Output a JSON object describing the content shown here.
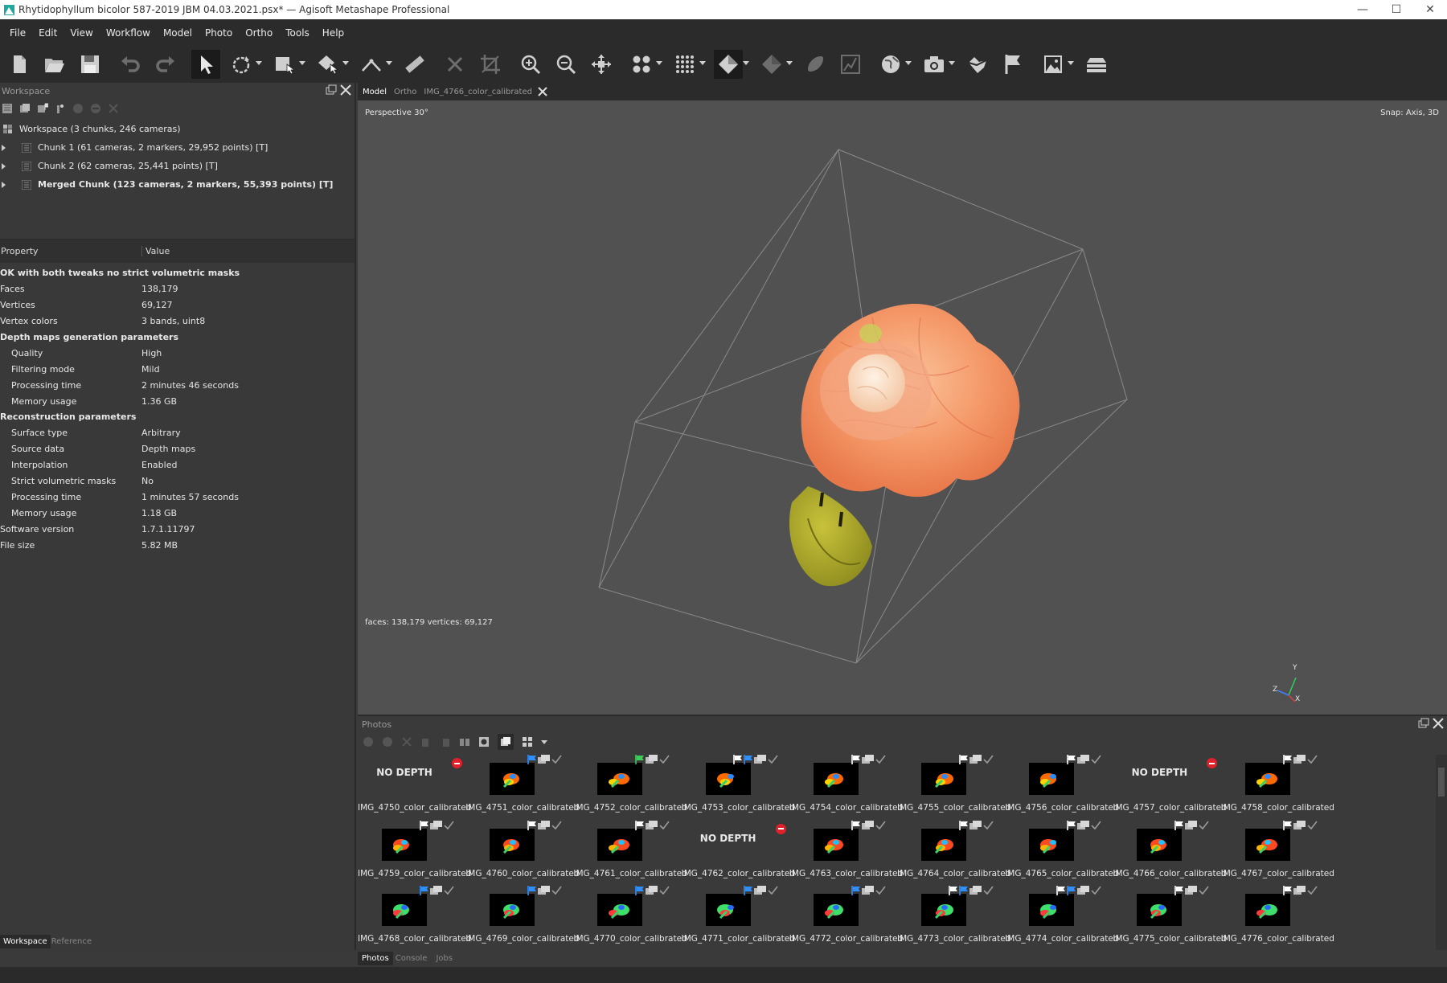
{
  "window": {
    "title": "Rhytidophyllum bicolor 587-2019 JBM 04.03.2021.psx* — Agisoft Metashape Professional",
    "minimize": "—",
    "maximize": "☐",
    "close": "✕"
  },
  "menu": [
    "File",
    "Edit",
    "View",
    "Workflow",
    "Model",
    "Photo",
    "Ortho",
    "Tools",
    "Help"
  ],
  "workspace": {
    "title": "Workspace",
    "root": "Workspace (3 chunks, 246 cameras)",
    "chunks": [
      "Chunk 1 (61 cameras, 2 markers, 29,952 points) [T]",
      "Chunk 2 (62 cameras, 25,441 points) [T]",
      "Merged Chunk (123 cameras, 2 markers, 55,393 points) [T]"
    ]
  },
  "properties": {
    "col_property": "Property",
    "col_value": "Value",
    "rows": [
      {
        "type": "group",
        "k": "OK with both tweaks no strict volumetric masks",
        "v": ""
      },
      {
        "type": "top",
        "k": "Faces",
        "v": "138,179"
      },
      {
        "type": "top",
        "k": "Vertices",
        "v": "69,127"
      },
      {
        "type": "top",
        "k": "Vertex colors",
        "v": "3 bands, uint8"
      },
      {
        "type": "group",
        "k": "Depth maps generation parameters",
        "v": ""
      },
      {
        "type": "sub",
        "k": "Quality",
        "v": "High"
      },
      {
        "type": "sub",
        "k": "Filtering mode",
        "v": "Mild"
      },
      {
        "type": "sub",
        "k": "Processing time",
        "v": "2 minutes 46 seconds"
      },
      {
        "type": "sub",
        "k": "Memory usage",
        "v": "1.36 GB"
      },
      {
        "type": "group",
        "k": "Reconstruction parameters",
        "v": ""
      },
      {
        "type": "sub",
        "k": "Surface type",
        "v": "Arbitrary"
      },
      {
        "type": "sub",
        "k": "Source data",
        "v": "Depth maps"
      },
      {
        "type": "sub",
        "k": "Interpolation",
        "v": "Enabled"
      },
      {
        "type": "sub",
        "k": "Strict volumetric masks",
        "v": "No"
      },
      {
        "type": "sub",
        "k": "Processing time",
        "v": "1 minutes 57 seconds"
      },
      {
        "type": "sub",
        "k": "Memory usage",
        "v": "1.18 GB"
      },
      {
        "type": "top",
        "k": "Software version",
        "v": "1.7.1.11797"
      },
      {
        "type": "top",
        "k": "File size",
        "v": "5.82 MB"
      }
    ]
  },
  "left_tabs": [
    "Workspace",
    "Reference"
  ],
  "view_tabs": [
    "Model",
    "Ortho",
    "IMG_4766_color_calibrated"
  ],
  "viewport": {
    "projection": "Perspective 30°",
    "snap": "Snap: Axis, 3D",
    "stats": "faces: 138,179 vertices: 69,127",
    "axis_z": "Z",
    "axis_y": "Y",
    "axis_x": "X"
  },
  "photos": {
    "title": "Photos",
    "no_depth": "NO DEPTH",
    "items": [
      {
        "name": "IMG_4750_color_calibrated",
        "nodepth": true
      },
      {
        "name": "IMG_4751_color_calibrated",
        "flag": "blue"
      },
      {
        "name": "IMG_4752_color_calibrated",
        "flag": "green"
      },
      {
        "name": "IMG_4753_color_calibrated",
        "flag": "white-blue"
      },
      {
        "name": "IMG_4754_color_calibrated",
        "flag": "white"
      },
      {
        "name": "IMG_4755_color_calibrated",
        "flag": "white"
      },
      {
        "name": "IMG_4756_color_calibrated",
        "flag": "white"
      },
      {
        "name": "IMG_4757_color_calibrated",
        "nodepth": true
      },
      {
        "name": "IMG_4758_color_calibrated",
        "flag": "white"
      },
      {
        "name": "IMG_4759_color_calibrated",
        "flag": "white"
      },
      {
        "name": "IMG_4760_color_calibrated",
        "flag": "white"
      },
      {
        "name": "IMG_4761_color_calibrated",
        "flag": "white"
      },
      {
        "name": "IMG_4762_color_calibrated",
        "nodepth": true
      },
      {
        "name": "IMG_4763_color_calibrated",
        "flag": "white"
      },
      {
        "name": "IMG_4764_color_calibrated",
        "flag": "white"
      },
      {
        "name": "IMG_4765_color_calibrated",
        "flag": "white"
      },
      {
        "name": "IMG_4766_color_calibrated",
        "flag": "white"
      },
      {
        "name": "IMG_4767_color_calibrated",
        "flag": "white"
      },
      {
        "name": "IMG_4768_color_calibrated",
        "flag": "blue"
      },
      {
        "name": "IMG_4769_color_calibrated",
        "flag": "blue"
      },
      {
        "name": "IMG_4770_color_calibrated",
        "flag": "blue"
      },
      {
        "name": "IMG_4771_color_calibrated",
        "flag": "blue"
      },
      {
        "name": "IMG_4772_color_calibrated",
        "flag": "blue"
      },
      {
        "name": "IMG_4773_color_calibrated",
        "flag": "white-blue"
      },
      {
        "name": "IMG_4774_color_calibrated",
        "flag": "white-blue"
      },
      {
        "name": "IMG_4775_color_calibrated",
        "flag": "white"
      },
      {
        "name": "IMG_4776_color_calibrated",
        "flag": "white"
      }
    ]
  },
  "bottom_tabs": [
    "Photos",
    "Console",
    "Jobs"
  ],
  "colors": {
    "flag_white": "#ffffff",
    "flag_blue": "#2f8fff",
    "flag_green": "#3ecb5a",
    "disabled_red": "#e0202a",
    "viewport_bg": "#515151"
  }
}
